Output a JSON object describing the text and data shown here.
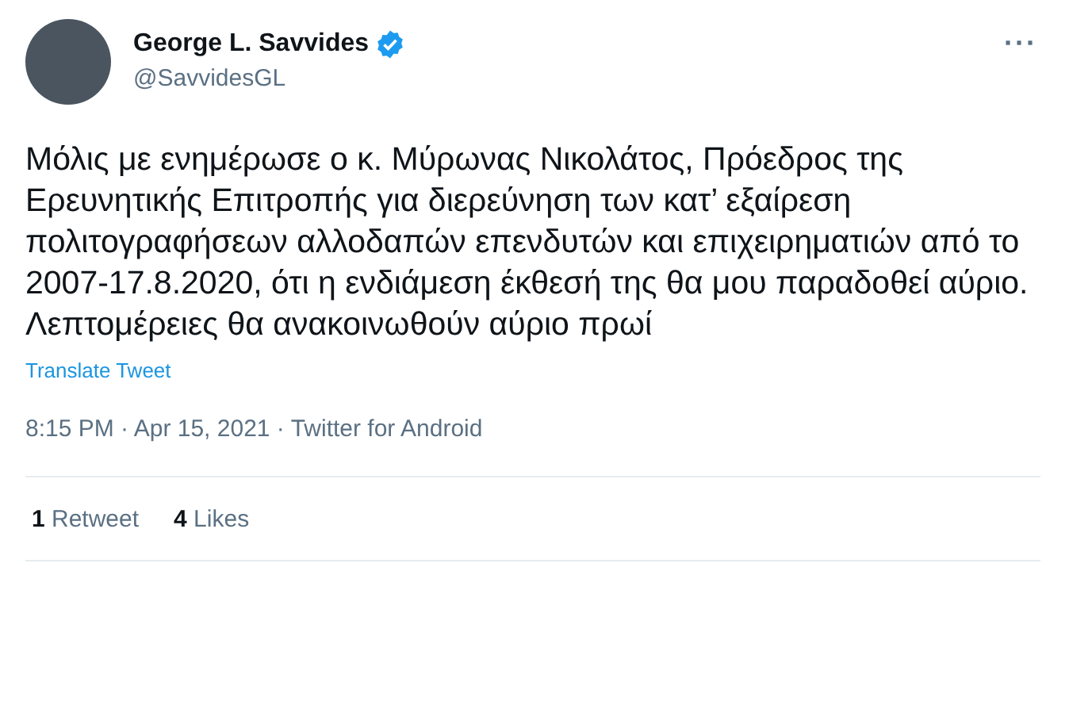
{
  "author": {
    "name": "George L. Savvides",
    "handle": "@SavvidesGL",
    "verified": true
  },
  "more_icon": "···",
  "text": "Μόλις με ενημέρωσε ο κ. Μύρωνας Νικολάτος, Πρόεδρος της Ερευνητικής Επιτροπής για διερεύνηση των κατ’ εξαίρεση πολιτογραφήσεων αλλοδαπών επενδυτών και επιχειρηματιών από το 2007-17.8.2020, ότι η ενδιάμεση έκθεσή της θα μου παραδοθεί αύριο. Λεπτομέρειες θα ανακοινωθούν αύριο πρωί",
  "translate_link": "Translate Tweet",
  "meta": "8:15 PM · Apr 15, 2021 · Twitter for Android",
  "stats": [
    {
      "count": "1",
      "label": "Retweet"
    },
    {
      "count": "4",
      "label": "Likes"
    }
  ]
}
